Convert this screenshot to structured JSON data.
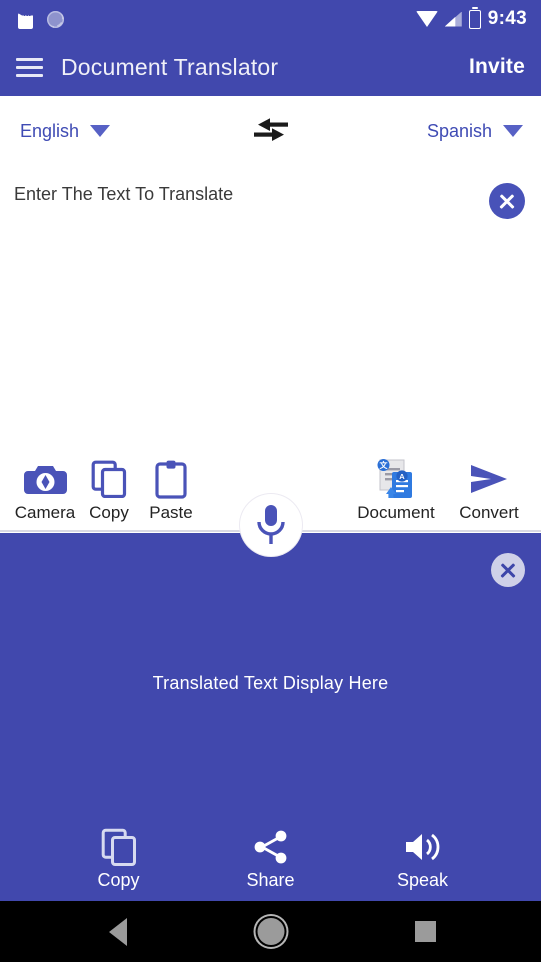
{
  "status_bar": {
    "time": "9:43",
    "icons": [
      "sd-card-icon",
      "sync-icon",
      "wifi-icon",
      "cellular-signal-icon",
      "battery-charging-icon"
    ]
  },
  "app_bar": {
    "menu_icon": "hamburger-menu-icon",
    "title": "Document Translator",
    "invite_label": "Invite"
  },
  "language_bar": {
    "source_language": "English",
    "target_language": "Spanish",
    "swap_icon": "swap-arrows-icon",
    "caret_icon": "chevron-down-icon"
  },
  "input_panel": {
    "placeholder": "Enter The Text To Translate",
    "value": "",
    "clear_icon": "close-circle-icon"
  },
  "input_toolbar": {
    "items": [
      {
        "label": "Camera",
        "icon": "camera-icon"
      },
      {
        "label": "Copy",
        "icon": "copy-icon"
      },
      {
        "label": "Paste",
        "icon": "paste-clipboard-icon"
      },
      {
        "label": "Document",
        "icon": "document-translate-icon"
      },
      {
        "label": "Convert",
        "icon": "send-arrow-icon"
      }
    ]
  },
  "mic_button": {
    "icon": "microphone-icon",
    "label": "Voice input"
  },
  "output_panel": {
    "text": "Translated Text Display Here",
    "clear_icon": "close-circle-icon"
  },
  "output_toolbar": {
    "items": [
      {
        "label": "Copy",
        "icon": "copy-icon"
      },
      {
        "label": "Share",
        "icon": "share-nodes-icon"
      },
      {
        "label": "Speak",
        "icon": "speaker-volume-icon"
      }
    ]
  },
  "nav_bar": {
    "back": "back-triangle-icon",
    "home": "home-circle-icon",
    "recents": "recents-square-icon"
  },
  "colors": {
    "primary": "#4148AD",
    "accent_text": "#3f4bb4",
    "icon_blue": "#4a53b8",
    "surface": "#ffffff",
    "on_primary": "#ffffff"
  }
}
